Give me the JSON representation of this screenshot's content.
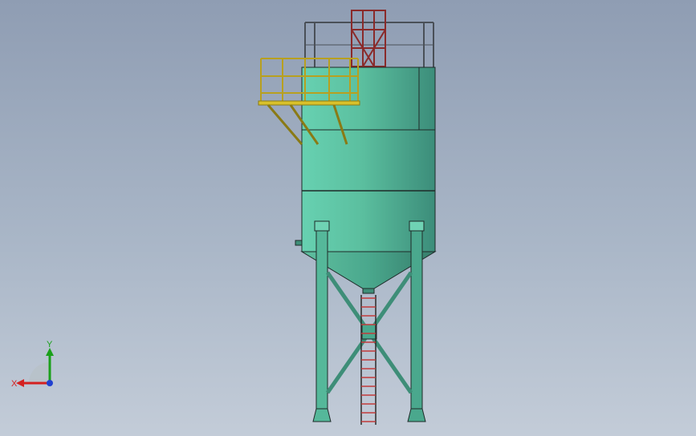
{
  "viewport": {
    "background_top": "#8f9db3",
    "background_bottom": "#c3ccd8"
  },
  "model": {
    "body_color": "#5fc7a8",
    "body_shade": "#3f9e86",
    "edge_color": "#1e2a28",
    "platform_color": "#d9c12a",
    "cage_color": "#8a2a2a",
    "railing_color": "#4a5058",
    "ladder_rung_color": "#c23a3a"
  },
  "triad": {
    "x_label": "X",
    "y_label": "Y",
    "x_color": "#d42020",
    "y_color": "#1aa01a",
    "z_color": "#2040d0"
  }
}
